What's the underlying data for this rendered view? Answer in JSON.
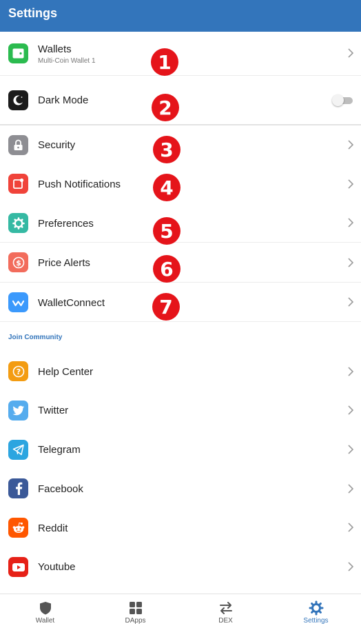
{
  "header": {
    "title": "Settings"
  },
  "settings": {
    "wallets": {
      "label": "Wallets",
      "sublabel": "Multi-Coin Wallet 1"
    },
    "dark_mode": {
      "label": "Dark Mode",
      "enabled": false
    },
    "security": {
      "label": "Security"
    },
    "push_notifications": {
      "label": "Push Notifications"
    },
    "preferences": {
      "label": "Preferences"
    },
    "price_alerts": {
      "label": "Price Alerts"
    },
    "walletconnect": {
      "label": "WalletConnect"
    }
  },
  "community": {
    "title": "Join Community",
    "items": [
      {
        "label": "Help Center",
        "icon": "help-icon",
        "color": "#f39c12"
      },
      {
        "label": "Twitter",
        "icon": "twitter-icon",
        "color": "#55acee"
      },
      {
        "label": "Telegram",
        "icon": "telegram-icon",
        "color": "#2ca5e0"
      },
      {
        "label": "Facebook",
        "icon": "facebook-icon",
        "color": "#3b5998"
      },
      {
        "label": "Reddit",
        "icon": "reddit-icon",
        "color": "#ff5700"
      },
      {
        "label": "Youtube",
        "icon": "youtube-icon",
        "color": "#e62117"
      }
    ]
  },
  "annotations": [
    "1",
    "2",
    "3",
    "4",
    "5",
    "6",
    "7"
  ],
  "tabs": [
    {
      "label": "Wallet",
      "icon": "shield-icon",
      "active": false
    },
    {
      "label": "DApps",
      "icon": "grid-icon",
      "active": false
    },
    {
      "label": "DEX",
      "icon": "swap-arrows-icon",
      "active": false
    },
    {
      "label": "Settings",
      "icon": "gear-icon",
      "active": true
    }
  ],
  "colors": {
    "brand": "#3375bb",
    "annotation_red": "#e5141a"
  }
}
